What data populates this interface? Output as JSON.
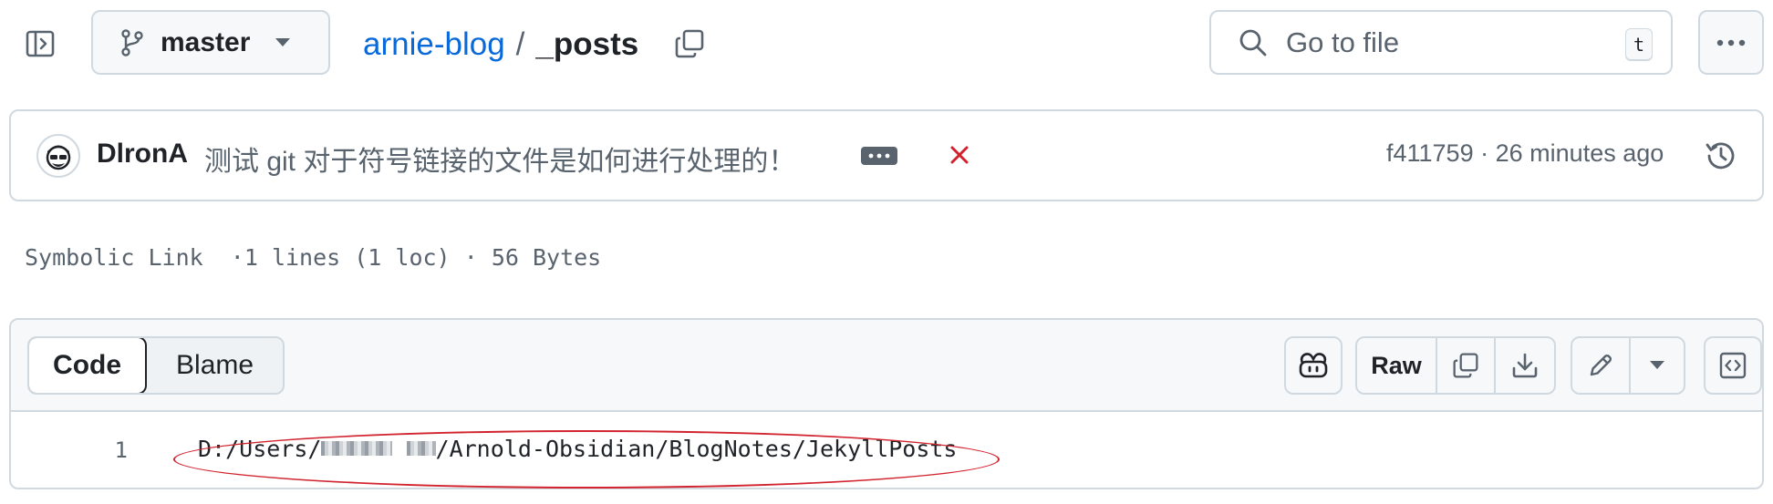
{
  "topbar": {
    "sidebar_toggle_icon": "sidebar-expand-icon",
    "branch": {
      "icon": "git-branch-icon",
      "label": "master",
      "caret_icon": "triangle-down-icon"
    },
    "breadcrumb": {
      "repo": "arnie-blog",
      "separator": "/",
      "current": "_posts"
    },
    "copy_path_icon": "copy-icon",
    "go_to_file": {
      "icon": "search-icon",
      "placeholder": "Go to file",
      "shortcut": "t"
    },
    "more_icon": "kebab-horizontal-icon"
  },
  "commit": {
    "author": "DlronA",
    "message": "测试 git 对于符号链接的文件是如何进行处理的！",
    "ellipsis_icon": "ellipsis-icon",
    "status_icon": "x-icon",
    "status_color": "#cf222e",
    "hash": "f411759",
    "meta_separator": "·",
    "time": "26 minutes ago",
    "history_icon": "history-icon"
  },
  "file_info": {
    "type": "Symbolic Link",
    "lines": "1 lines (1 loc)",
    "size": "56 Bytes",
    "separator": "·"
  },
  "code_panel": {
    "tabs": [
      {
        "label": "Code",
        "selected": true
      },
      {
        "label": "Blame",
        "selected": false
      }
    ],
    "copilot_icon": "copilot-icon",
    "raw_label": "Raw",
    "copy_raw_icon": "copy-icon",
    "download_icon": "download-icon",
    "edit_icon": "pencil-icon",
    "edit_menu_icon": "triangle-down-icon",
    "symbols_icon": "code-square-icon",
    "lines": [
      {
        "number": "1",
        "text_before": "D:/Users/",
        "text_after": "/Arnold-Obsidian/BlogNotes/JekyllPosts"
      }
    ],
    "annotation_color": "#d1242f"
  },
  "colors": {
    "link": "#0969da",
    "border": "#d1d9e0",
    "muted": "#59636e",
    "header_bg": "#f6f8fa"
  }
}
